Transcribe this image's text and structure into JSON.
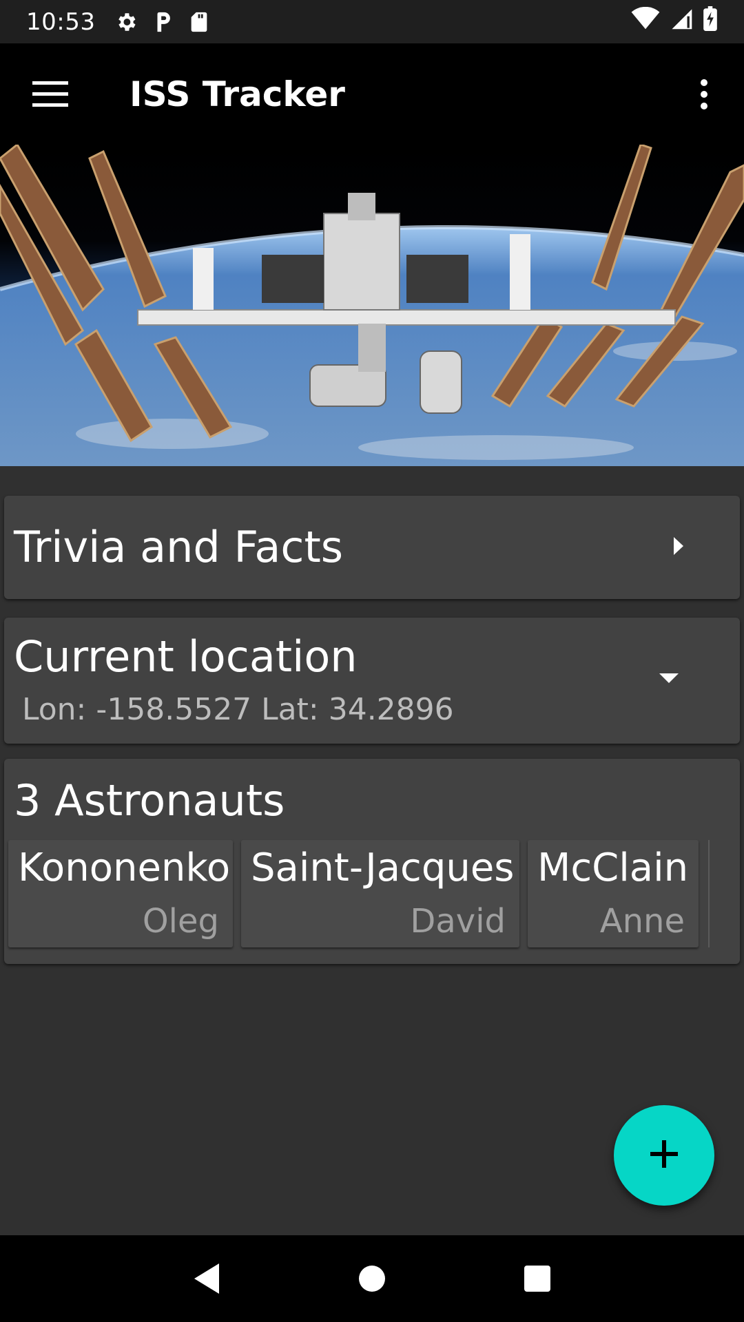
{
  "status_bar": {
    "time": "10:53",
    "left_icons": [
      "gear-icon",
      "parking-icon",
      "sd-card-icon"
    ],
    "right_icons": [
      "wifi-icon",
      "signal-icon",
      "battery-charging-icon"
    ]
  },
  "app_bar": {
    "title": "ISS Tracker",
    "menu_icon": "hamburger-menu-icon",
    "overflow_icon": "more-vert-icon"
  },
  "hero": {
    "image": "iss-space-station-photo"
  },
  "trivia_card": {
    "title": "Trivia and Facts",
    "icon": "arrow-right-icon"
  },
  "location_card": {
    "title": "Current location",
    "coords": "Lon: -158.5527 Lat: 34.2896",
    "icon": "arrow-drop-down-icon"
  },
  "astronauts_card": {
    "title": "3 Astronauts",
    "items": [
      {
        "last": "Kononenko",
        "first": "Oleg"
      },
      {
        "last": "Saint-Jacques",
        "first": "David"
      },
      {
        "last": "McClain",
        "first": "Anne"
      }
    ]
  },
  "fab": {
    "icon": "plus-icon",
    "color": "#06d6c6"
  },
  "nav_bar": {
    "icons": [
      "back-icon",
      "home-icon",
      "recents-icon"
    ]
  }
}
